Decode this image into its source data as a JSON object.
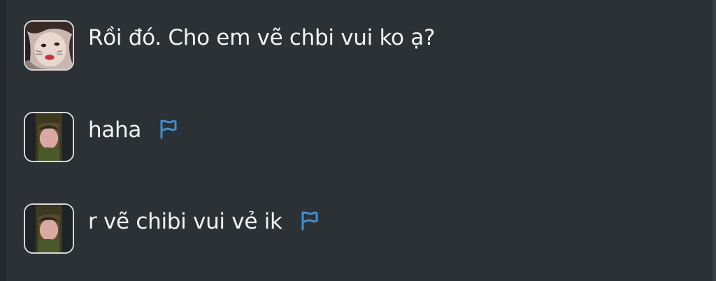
{
  "messages": [
    {
      "text": "Rồi đó. Cho em vẽ chbi vui ko ạ?",
      "avatar_icon": "user-avatar-girl-icon",
      "flag": false
    },
    {
      "text": "haha",
      "avatar_icon": "user-avatar-photo-icon",
      "flag": true,
      "flag_icon": "flag-icon",
      "flag_color": "#3f8fd0"
    },
    {
      "text": "r vẽ chibi vui vẻ ik",
      "avatar_icon": "user-avatar-photo-icon",
      "flag": true,
      "flag_icon": "flag-icon",
      "flag_color": "#3f8fd0"
    }
  ],
  "colors": {
    "background": "#2c3135",
    "text": "#f2f2f2",
    "avatar_border": "#d8d8d8",
    "flag": "#3f8fd0"
  }
}
